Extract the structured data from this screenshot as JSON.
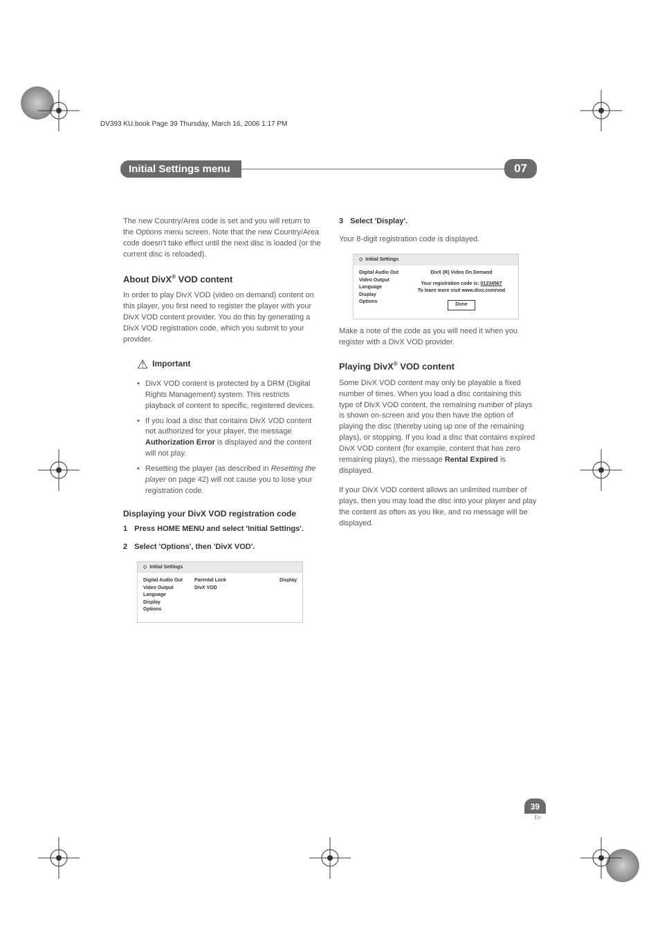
{
  "header_line": "DV393 KU.book  Page 39  Thursday, March 16, 2006  1:17 PM",
  "chapter_title": "Initial Settings menu",
  "chapter_number": "07",
  "col1": {
    "intro": "The new Country/Area code is set and you will return to the Options menu screen. Note that the new Country/Area code doesn't take effect until the next disc is loaded (or the current disc is reloaded).",
    "about_heading_pre": "About DivX",
    "about_heading_post": " VOD content",
    "about_body": "In order to play DivX VOD (video on demand) content on this player, you first need to register the player with your DivX VOD content provider. You do this by generating a DivX VOD registration code, which you submit to your provider.",
    "important_label": "Important",
    "bullet1": "DivX VOD content is protected by a DRM (Digital Rights Management) system. This restricts playback of content to specific, registered devices.",
    "bullet2_pre": "If you load a disc that contains DivX VOD content not authorized for your player, the message ",
    "bullet2_bold": "Authorization Error",
    "bullet2_post": " is displayed and the content will not play.",
    "bullet3_pre": "Resetting the player (as described in ",
    "bullet3_italic": "Resetting the player",
    "bullet3_post": " on page 42) will not cause you to lose your registration code.",
    "display_heading": "Displaying your DivX VOD registration code",
    "step1_num": "1",
    "step1": "Press HOME MENU and select 'Initial Settings'.",
    "step2_num": "2",
    "step2": "Select 'Options', then 'DivX VOD'.",
    "ss1": {
      "title": "Initial Settings",
      "side1": "Digital Audio Out",
      "side2": "Video Output",
      "side3": "Language",
      "side4": "Display",
      "side5": "Options",
      "mid1": "Parental Lock",
      "mid2": "DivX VOD",
      "right1": "Display"
    }
  },
  "col2": {
    "step3_num": "3",
    "step3": "Select 'Display'.",
    "step3_body": "Your 8-digit registration code is displayed.",
    "ss2": {
      "title": "Initial Settings",
      "side1": "Digital Audio Out",
      "side2": "Video Output",
      "side3": "Language",
      "side4": "Display",
      "side5": "Options",
      "center1": "DivX (R) Video On Demand",
      "center2_pre": "Your registration code is:  ",
      "center2_code": "01234567",
      "center3": "To learn more visit www.divx.com/vod",
      "done": "Done"
    },
    "note": "Make a note of the code as you will need it when you register with a DivX VOD provider.",
    "playing_heading_pre": "Playing DivX",
    "playing_heading_post": " VOD content",
    "playing_body_pre": "Some DivX VOD content may only be playable a fixed number of times. When you load a disc containing this type of DivX VOD content, the remaining number of plays is shown on-screen and you then have the option of playing the disc (thereby using up one of the remaining plays), or stopping. If you load a disc that contains expired DivX VOD content (for example, content that has zero remaining plays), the message ",
    "playing_body_bold": "Rental Expired",
    "playing_body_post": " is displayed.",
    "playing_body2": "If your DivX VOD content allows an unlimited number of plays, then you may load the disc into your player and play the content as often as you like, and no message will be displayed."
  },
  "page_number": "39",
  "page_lang": "En"
}
